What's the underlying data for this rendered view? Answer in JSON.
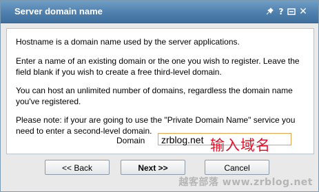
{
  "window": {
    "title": "Server domain name",
    "controls": {
      "pin_icon": "pin-icon",
      "help_label": "?",
      "restore_icon": "restore-icon",
      "close_label": "✕"
    }
  },
  "content": {
    "paragraphs": [
      "Hostname is a domain name used by the server applications.",
      "Enter a name of an existing domain or the one you wish to register. Leave the field blank if you wish to create a free third-level domain.",
      "You can host an unlimited number of domains, regardless the domain name you've registered.",
      "Please note: if your are going to use the \"Private Domain Name\" service you need to enter a second-level domain."
    ],
    "domain_label": "Domain",
    "domain_value": "zrblog.net",
    "annotation": "输入域名"
  },
  "buttons": {
    "back": "<< Back",
    "next": "Next >>",
    "cancel": "Cancel"
  },
  "watermark": "越客部落 www.zrblog.net",
  "colors": {
    "titlebar": "#4f80ad",
    "annotation": "#e0122a",
    "input_border": "#e3a34d"
  }
}
